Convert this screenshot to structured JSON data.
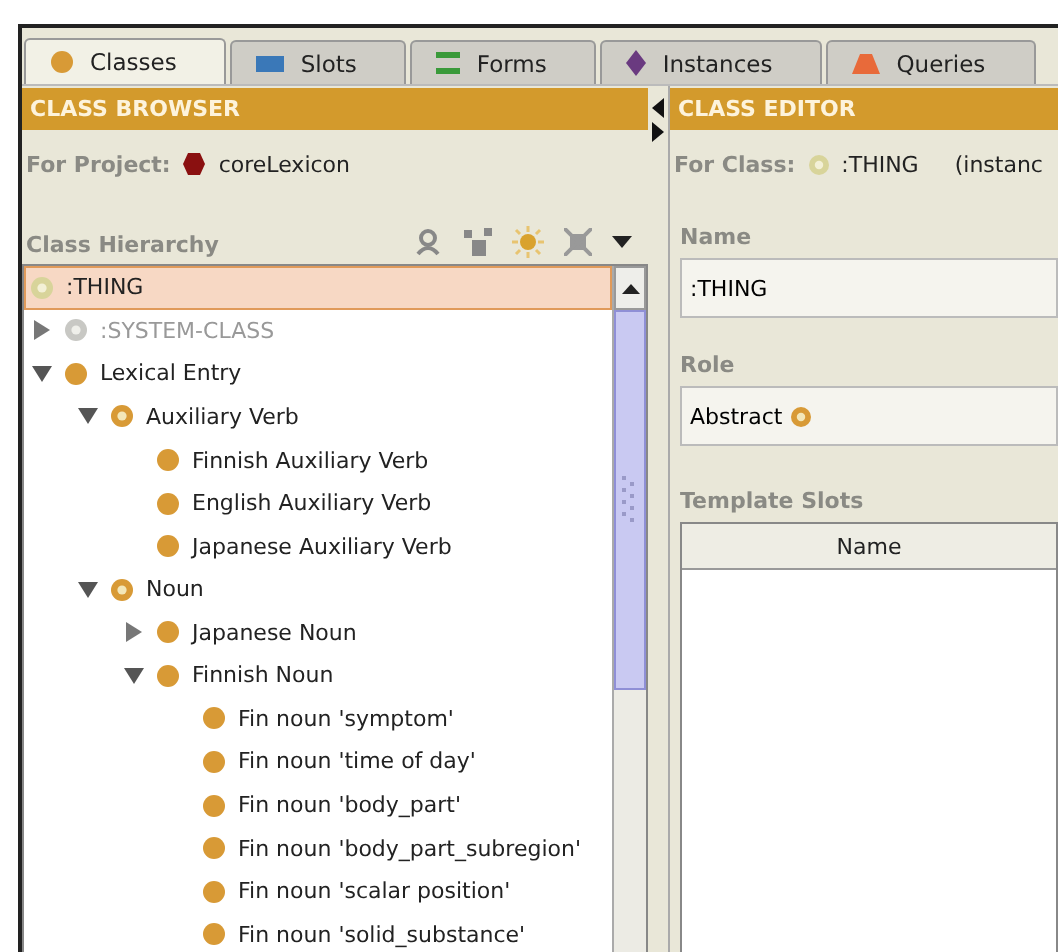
{
  "tabs": [
    {
      "label": "Classes",
      "kind": "classes",
      "selected": true
    },
    {
      "label": "Slots",
      "kind": "slots",
      "selected": false
    },
    {
      "label": "Forms",
      "kind": "forms",
      "selected": false
    },
    {
      "label": "Instances",
      "kind": "instances",
      "selected": false
    },
    {
      "label": "Queries",
      "kind": "queries",
      "selected": false
    }
  ],
  "class_browser": {
    "title": "CLASS BROWSER",
    "project_label": "For Project:",
    "project": "coreLexicon",
    "hierarchy_label": "Class Hierarchy",
    "tree": [
      {
        "label": ":THING",
        "kind": "root",
        "selected": true,
        "children": [
          {
            "label": ":SYSTEM-CLASS",
            "kind": "system",
            "selected": false,
            "expanded": false
          },
          {
            "label": "Lexical Entry",
            "kind": "concrete",
            "selected": false,
            "expanded": true,
            "children": [
              {
                "label": "Auxiliary Verb",
                "kind": "abstract",
                "selected": false,
                "expanded": true,
                "children": [
                  {
                    "label": "Finnish Auxiliary Verb",
                    "kind": "concrete",
                    "selected": false
                  },
                  {
                    "label": "English Auxiliary Verb",
                    "kind": "concrete",
                    "selected": false
                  },
                  {
                    "label": "Japanese Auxiliary Verb",
                    "kind": "concrete",
                    "selected": false
                  }
                ]
              },
              {
                "label": "Noun",
                "kind": "abstract",
                "selected": false,
                "expanded": true,
                "children": [
                  {
                    "label": "Japanese Noun",
                    "kind": "concrete",
                    "selected": false,
                    "expanded": false
                  },
                  {
                    "label": "Finnish Noun",
                    "kind": "concrete",
                    "selected": false,
                    "expanded": true,
                    "children": [
                      {
                        "label": "Fin noun 'symptom'",
                        "kind": "concrete",
                        "selected": false
                      },
                      {
                        "label": "Fin noun 'time of day'",
                        "kind": "concrete",
                        "selected": false
                      },
                      {
                        "label": "Fin noun 'body_part'",
                        "kind": "concrete",
                        "selected": false
                      },
                      {
                        "label": "Fin noun 'body_part_subregion'",
                        "kind": "concrete",
                        "selected": false
                      },
                      {
                        "label": "Fin noun 'scalar position'",
                        "kind": "concrete",
                        "selected": false
                      },
                      {
                        "label": "Fin noun 'solid_substance'",
                        "kind": "concrete",
                        "selected": false
                      }
                    ]
                  }
                ]
              }
            ]
          }
        ]
      }
    ]
  },
  "class_editor": {
    "title": "CLASS EDITOR",
    "class_label": "For Class:",
    "class_name": ":THING",
    "class_note": "(instanc",
    "name_label": "Name",
    "name_value": ":THING",
    "role_label": "Role",
    "role_value": "Abstract",
    "slots_label": "Template Slots",
    "slots_columns": [
      "Name"
    ]
  }
}
